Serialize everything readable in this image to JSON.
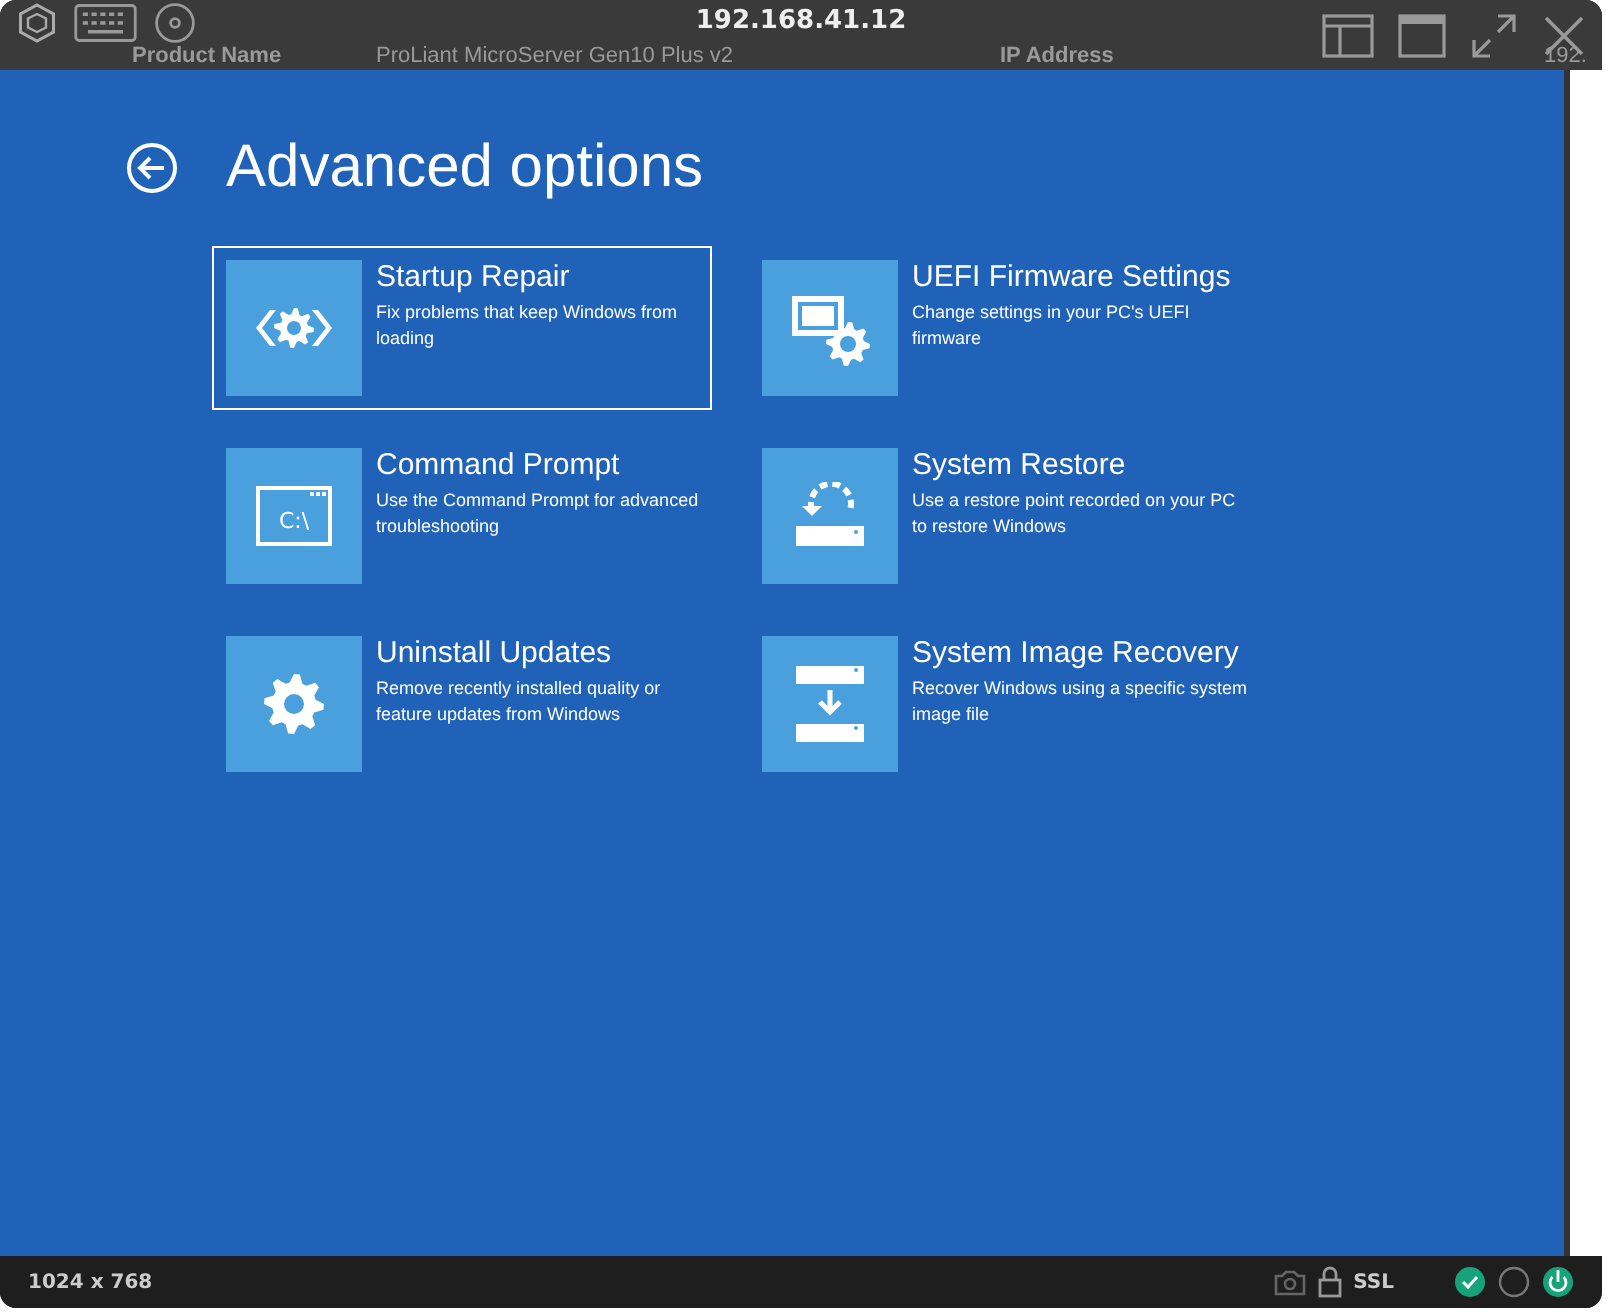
{
  "window": {
    "title": "192.168.41.12"
  },
  "background_page": {
    "texts": [
      "Product Name",
      "ProLiant MicroServer Gen10 Plus v2",
      "IP Address",
      "192."
    ]
  },
  "screen": {
    "title": "Advanced options",
    "options": [
      {
        "kind": "startup-repair",
        "title": "Startup Repair",
        "description": "Fix problems that keep Windows from loading",
        "selected": true
      },
      {
        "kind": "uefi",
        "title": "UEFI Firmware Settings",
        "description": "Change settings in your PC's UEFI firmware",
        "selected": false
      },
      {
        "kind": "command-prompt",
        "glyph": "C:\\",
        "title": "Command Prompt",
        "description": "Use the Command Prompt for advanced troubleshooting",
        "selected": false
      },
      {
        "kind": "system-restore",
        "title": "System Restore",
        "description": "Use a restore point recorded on your PC to restore Windows",
        "selected": false
      },
      {
        "kind": "uninstall-updates",
        "title": "Uninstall Updates",
        "description": "Remove recently installed quality or feature updates from Windows",
        "selected": false
      },
      {
        "kind": "image-recovery",
        "title": "System Image Recovery",
        "description": "Recover Windows using a specific system image file",
        "selected": false
      }
    ]
  },
  "status_bar": {
    "resolution": "1024 x 768",
    "security": "SSL"
  }
}
